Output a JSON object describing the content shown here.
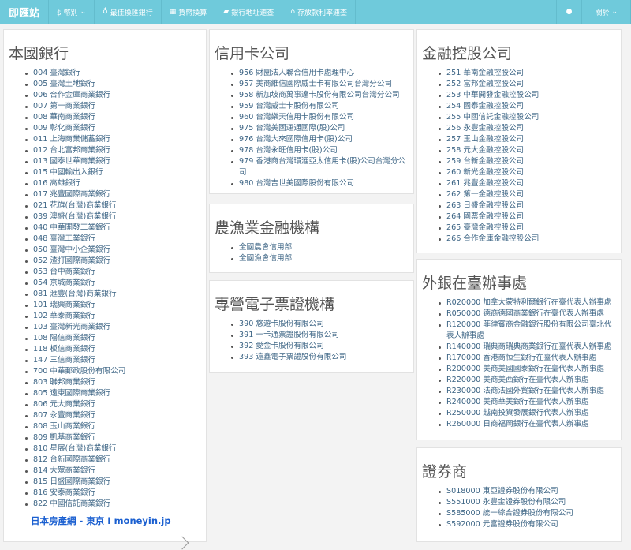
{
  "nav": {
    "brand": "即匯站",
    "currency": "$ 幣別",
    "best": "最佳換匯銀行",
    "convert": "貨幣換算",
    "address": "銀行地址速查",
    "rates": "存放款利率速查",
    "about": "關於"
  },
  "sections": {
    "domestic": {
      "title": "本國銀行",
      "items": [
        "004 臺灣銀行",
        "005 臺灣土地銀行",
        "006 合作金庫商業銀行",
        "007 第一商業銀行",
        "008 華南商業銀行",
        "009 彰化商業銀行",
        "011 上海商業儲蓄銀行",
        "012 台北富邦商業銀行",
        "013 國泰世華商業銀行",
        "015 中國輸出入銀行",
        "016 高雄銀行",
        "017 兆豐國際商業銀行",
        "021 花旗(台灣)商業銀行",
        "039 澳盛(台灣)商業銀行",
        "040 中華開發工業銀行",
        "048 臺灣工業銀行",
        "050 臺灣中小企業銀行",
        "052 渣打國際商業銀行",
        "053 台中商業銀行",
        "054 京城商業銀行",
        "081 滙豐(台灣)商業銀行",
        "101 瑞興商業銀行",
        "102 華泰商業銀行",
        "103 臺灣新光商業銀行",
        "108 陽信商業銀行",
        "118 板信商業銀行",
        "147 三信商業銀行",
        "700 中華郵政股份有限公司",
        "803 聯邦商業銀行",
        "805 遠東國際商業銀行",
        "806 元大商業銀行",
        "807 永豐商業銀行",
        "808 玉山商業銀行",
        "809 凱基商業銀行",
        "810 星展(台灣)商業銀行",
        "812 台新國際商業銀行",
        "814 大眾商業銀行",
        "815 日盛國際商業銀行",
        "816 安泰商業銀行",
        "822 中國信託商業銀行"
      ]
    },
    "credit": {
      "title": "信用卡公司",
      "items": [
        "956 財團法人聯合信用卡處理中心",
        "957 美商維信國際威士卡有限公司台灣分公司",
        "958 新加坡商萬事達卡股份有限公司台灣分公司",
        "959 台灣威士卡股份有限公司",
        "960 台灣樂天信用卡股份有限公司",
        "975 台灣美國運通國際(股)公司",
        "976 台灣大來國際信用卡(股)公司",
        "978 台灣永旺信用卡(股)公司",
        "979 香港商台灣環滙亞太信用卡(股)公司台灣分公司",
        "980 台灣吉世美國際股份有限公司"
      ]
    },
    "agri": {
      "title": "農漁業金融機構",
      "items": [
        "全國農會信用部",
        "全國漁會信用部"
      ]
    },
    "eticket": {
      "title": "專營電子票證機構",
      "items": [
        "390 悠遊卡股份有限公司",
        "391 一卡通票證股份有限公司",
        "392 愛金卡股份有限公司",
        "393 遠鑫電子票證股份有限公司"
      ]
    },
    "holding": {
      "title": "金融控股公司",
      "items": [
        "251 華南金融控股公司",
        "252 富邦金融控股公司",
        "253 中華開發金融控股公司",
        "254 國泰金融控股公司",
        "255 中國信託金融控股公司",
        "256 永豐金融控股公司",
        "257 玉山金融控股公司",
        "258 元大金融控股公司",
        "259 台新金融控股公司",
        "260 新光金融控股公司",
        "261 兆豐金融控股公司",
        "262 第一金融控股公司",
        "263 日盛金融控股公司",
        "264 國票金融控股公司",
        "265 臺灣金融控股公司",
        "266 合作金庫金融控股公司"
      ]
    },
    "foreign": {
      "title": "外銀在臺辦事處",
      "items": [
        "R020000 加拿大蒙特利爾銀行在臺代表人辦事處",
        "R050000 德商德國商業銀行在臺代表人辦事處",
        "R120000 菲律賓商金融銀行股份有限公司臺北代表人辦事處",
        "R140000 瑞典商瑞典商業銀行在臺代表人辦事處",
        "R170000 香港商恒生銀行在臺代表人辦事處",
        "R200000 美商美國國泰銀行在臺代表人辦事處",
        "R220000 美商美西銀行在臺代表人辦事處",
        "R230000 法商法國外貿銀行在臺代表人辦事處",
        "R240000 美商華美銀行在臺代表人辦事處",
        "R250000 越南投資發展銀行代表人辦事處",
        "R260000 日商福岡銀行在臺代表人辦事處"
      ]
    },
    "securities": {
      "title": "證券商",
      "items": [
        "S018000 東亞證券股份有限公司",
        "S551000 永豐金證券股份有限公司",
        "S585000 統一綜合證券股份有限公司",
        "S592000 元富證券股份有限公司"
      ]
    }
  },
  "ad": {
    "title": "日本房產網 - 東京 I moneyin.jp"
  }
}
